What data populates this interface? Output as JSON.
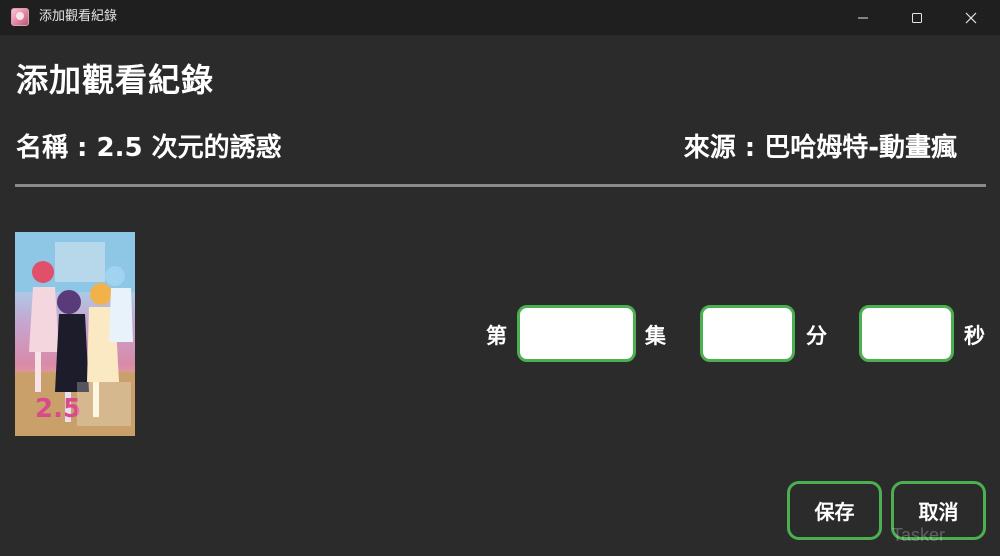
{
  "window": {
    "title": "添加觀看紀錄",
    "icon": "anime-avatar-icon",
    "controls": [
      "minimize-icon",
      "maximize-icon",
      "close-icon"
    ]
  },
  "header": {
    "title": "添加觀看紀錄",
    "name_line": "名稱 : 2.5 次元的誘惑",
    "source_line": "來源 : 巴哈姆特-動畫瘋"
  },
  "cover": {
    "description_icon": "anime-cover-image"
  },
  "progress": {
    "episode_prefix": "第",
    "episode_suffix": "集",
    "minutes_label": "分",
    "seconds_label": "秒",
    "episode_value": "",
    "minutes_value": "",
    "seconds_value": ""
  },
  "actions": {
    "save_label": "保存",
    "cancel_label": "取消"
  },
  "watermark": "Tasker",
  "colors": {
    "background": "#2b2b2b",
    "titlebar": "#1f1f1f",
    "accent_border": "#4caf50",
    "divider": "#8a8a8a"
  }
}
